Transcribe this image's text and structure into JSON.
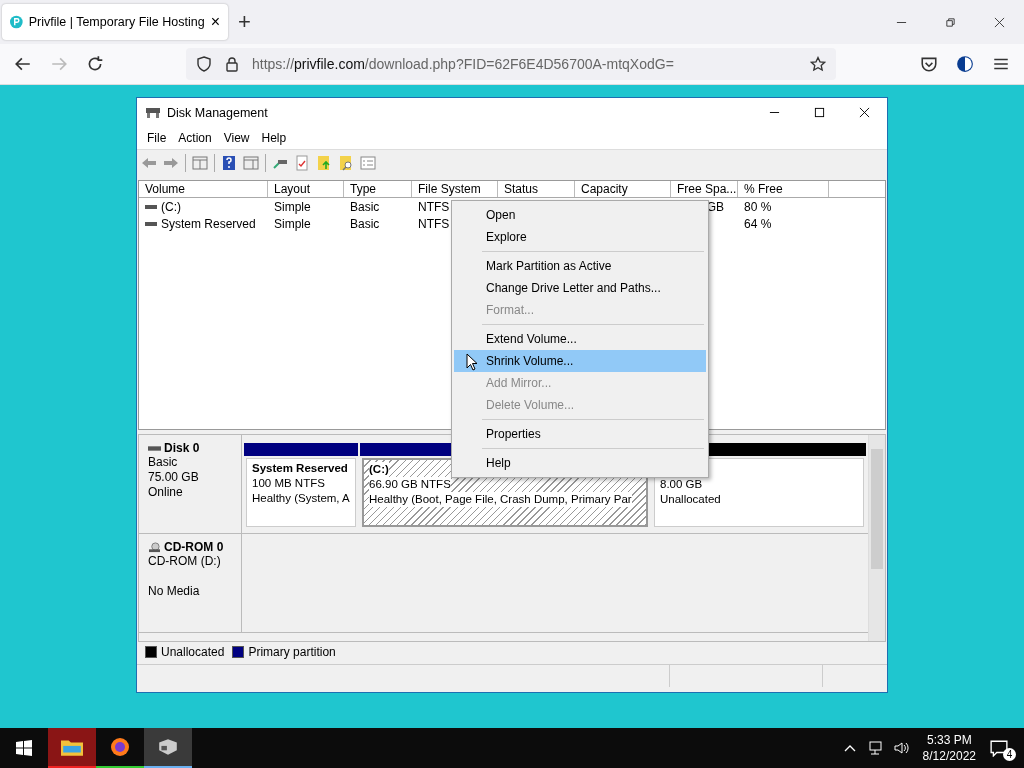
{
  "browser": {
    "tab": {
      "title": "Privfile | Temporary File Hosting",
      "close": "×"
    },
    "new_tab": "+",
    "url": {
      "scheme": "https://",
      "host": "privfile.com",
      "path": "/download.php?FID=62F6E4D56700A-mtqXodG="
    }
  },
  "window": {
    "title": "Disk Management",
    "menu": [
      "File",
      "Action",
      "View",
      "Help"
    ],
    "columns": [
      "Volume",
      "Layout",
      "Type",
      "File System",
      "Status",
      "Capacity",
      "Free Spa...",
      "% Free"
    ],
    "rows": [
      {
        "volume": "(C:)",
        "layout": "Simple",
        "type": "Basic",
        "file_system": "NTFS",
        "free_space": "GB",
        "percent_free": "80 %"
      },
      {
        "volume": "System Reserved",
        "layout": "Simple",
        "type": "Basic",
        "file_system": "NTFS",
        "percent_free": "64 %"
      }
    ],
    "disks": [
      {
        "kind": "disk",
        "name": "Disk 0",
        "lines": [
          "Basic",
          "75.00 GB",
          "Online"
        ],
        "partitions": [
          {
            "kind": "primary",
            "title": "System Reserved",
            "size": "100 MB NTFS",
            "status": "Healthy (System, A",
            "selected": false
          },
          {
            "kind": "primary",
            "title": "(C:)",
            "size": "66.90 GB NTFS",
            "status": "Healthy (Boot, Page File, Crash Dump, Primary Par",
            "selected": true
          },
          {
            "kind": "unallocated",
            "size": "8.00 GB",
            "status": "Unallocated",
            "selected": false
          }
        ]
      },
      {
        "kind": "cdrom",
        "name": "CD-ROM 0",
        "lines": [
          "CD-ROM (D:)"
        ],
        "media": "No Media"
      }
    ],
    "legend": [
      {
        "label": "Unallocated",
        "color": "#000000"
      },
      {
        "label": "Primary partition",
        "color": "#000080"
      }
    ],
    "context_menu": [
      [
        {
          "label": "Open",
          "disabled": false,
          "selected": false
        },
        {
          "label": "Explore",
          "disabled": false,
          "selected": false
        }
      ],
      [
        {
          "label": "Mark Partition as Active",
          "disabled": false,
          "selected": false
        },
        {
          "label": "Change Drive Letter and Paths...",
          "disabled": false,
          "selected": false
        },
        {
          "label": "Format...",
          "disabled": true,
          "selected": false
        }
      ],
      [
        {
          "label": "Extend Volume...",
          "disabled": false,
          "selected": false
        },
        {
          "label": "Shrink Volume...",
          "disabled": false,
          "selected": true
        },
        {
          "label": "Add Mirror...",
          "disabled": true,
          "selected": false
        },
        {
          "label": "Delete Volume...",
          "disabled": true,
          "selected": false
        }
      ],
      [
        {
          "label": "Properties",
          "disabled": false,
          "selected": false
        }
      ],
      [
        {
          "label": "Help",
          "disabled": false,
          "selected": false
        }
      ]
    ]
  },
  "taskbar": {
    "apps": [
      {
        "kind": "explorer",
        "selected": false
      },
      {
        "kind": "firefox",
        "selected": false
      },
      {
        "kind": "diskmgmt",
        "selected": true
      }
    ],
    "time": "5:33 PM",
    "date": "8/12/2022",
    "notifications": "4"
  }
}
